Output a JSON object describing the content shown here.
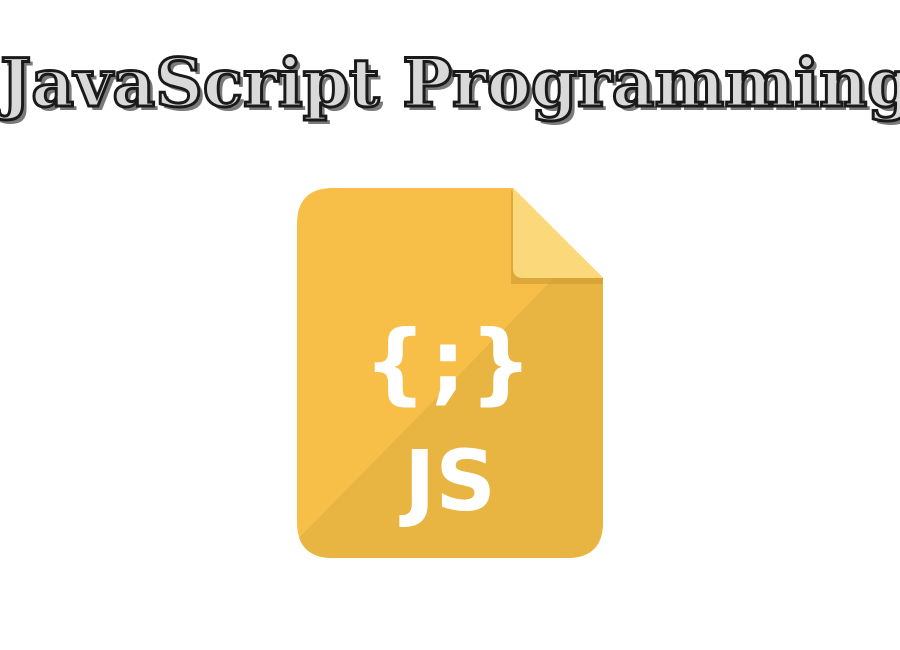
{
  "heading": {
    "title": "JavaScript Programming"
  },
  "file_icon": {
    "icon": "js-file-icon",
    "braces_text": "{;}",
    "label": "JS",
    "colors": {
      "body": "#F7BF47",
      "shade": "#E8B442",
      "fold": "#FBD97A",
      "fold_shadow": "#C9972F",
      "text": "#FFFFFF"
    }
  }
}
